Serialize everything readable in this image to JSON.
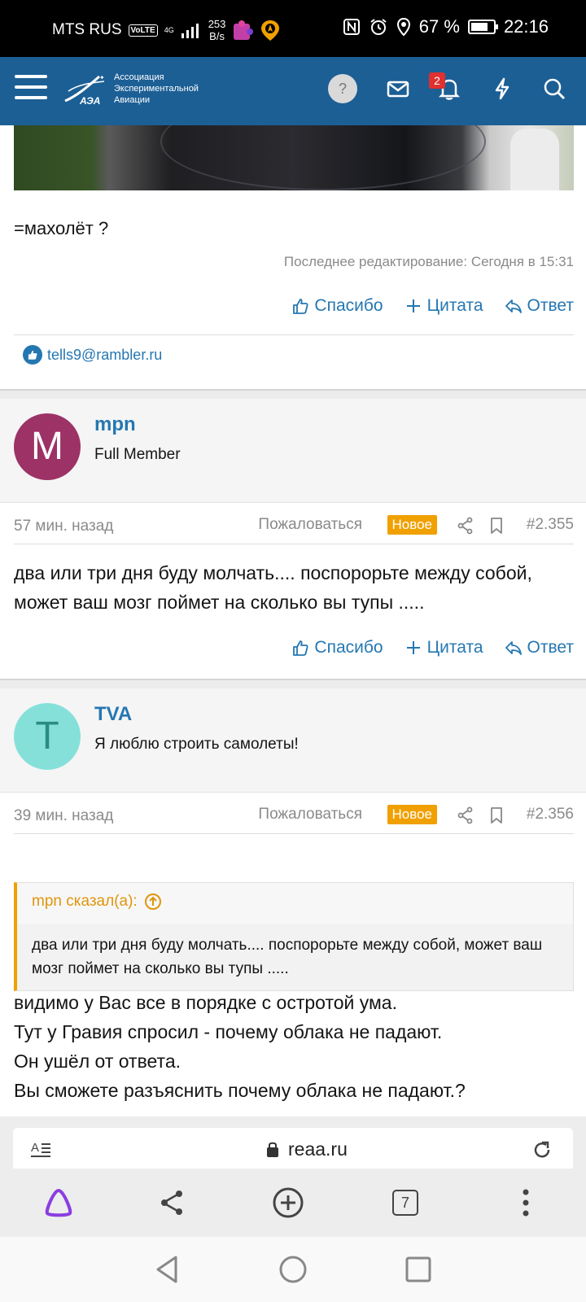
{
  "status_bar": {
    "carrier": "MTS RUS",
    "volte": "VoLTE",
    "network": "4G",
    "speed_value": "253",
    "speed_unit": "B/s",
    "battery": "67 %",
    "time": "22:16"
  },
  "app_header": {
    "logo_line1": "Ассоциация",
    "logo_line2": "Экспериментальной",
    "logo_line3": "Авиации",
    "logo_abbr": "АЭА",
    "help_label": "?",
    "notifications_count": "2"
  },
  "post_prev": {
    "message": "=махолёт ?",
    "edited": "Последнее редактирование: Сегодня в 15:31",
    "thanks_label": "Спасибо",
    "quote_label": "Цитата",
    "reply_label": "Ответ",
    "liked_by": "tells9@rambler.ru"
  },
  "post_mpn": {
    "avatar_letter": "M",
    "avatar_color": "#9c3266",
    "username": "mpn",
    "user_title": "Full Member",
    "time": "57 мин. назад",
    "report_label": "Пожаловаться",
    "new_badge": "Новое",
    "post_number": "#2.355",
    "message": "два или три дня буду молчать.... поспорорьте между собой, может ваш мозг поймет на сколько вы тупы .....",
    "thanks_label": "Спасибо",
    "quote_label": "Цитата",
    "reply_label": "Ответ"
  },
  "post_tva": {
    "avatar_letter": "T",
    "avatar_color": "#86e0da",
    "username": "TVA",
    "user_title": "Я люблю строить самолеты!",
    "time": "39 мин. назад",
    "report_label": "Пожаловаться",
    "new_badge": "Новое",
    "post_number": "#2.356",
    "quote_author": "mpn сказал(а):",
    "quote_text": "два или три дня буду молчать.... поспорорьте между собой, может ваш мозг поймет на сколько вы тупы .....",
    "line1": "видимо у Вас все в порядке с остротой ума.",
    "line2": "Тут у Гравия спросил - почему облака не падают.",
    "line3": "Он ушёл от ответа.",
    "line4": "Вы сможете разъяснить почему облака не падают.?"
  },
  "browser": {
    "domain": "reaa.ru",
    "tabs_count": "7"
  },
  "colors": {
    "header": "#1c5f95",
    "link": "#2577b1",
    "new_badge": "#f0a000",
    "alice": "#8a3ee0"
  }
}
